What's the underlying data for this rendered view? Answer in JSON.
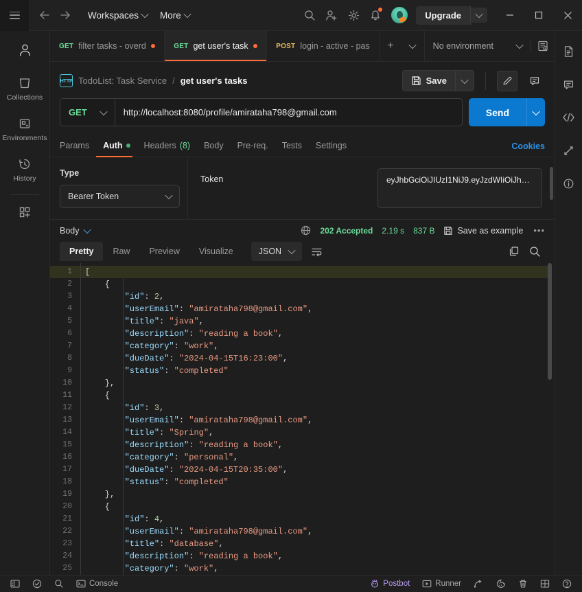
{
  "topbar": {
    "hamburger_icon": "hamburger-icon",
    "back_icon": "arrow-left-icon",
    "forward_icon": "arrow-right-icon",
    "workspaces_label": "Workspaces",
    "more_label": "More",
    "search_icon": "search-icon",
    "invite_icon": "user-plus-icon",
    "settings_icon": "gear-icon",
    "notifications_icon": "bell-icon",
    "avatar_name": "user-avatar",
    "upgrade_label": "Upgrade",
    "minimize_icon": "minimize-icon",
    "maximize_icon": "maximize-icon",
    "close_icon": "close-icon",
    "notification_dot_color": "#ff6c37"
  },
  "sidebar": {
    "avatar_icon": "person-icon",
    "items": [
      {
        "label": "Collections",
        "icon": "collections-icon"
      },
      {
        "label": "Environments",
        "icon": "environments-icon"
      },
      {
        "label": "History",
        "icon": "history-icon"
      }
    ],
    "new_icon": "new-grid-icon"
  },
  "tabs": {
    "items": [
      {
        "method": "GET",
        "name": "filter tasks - overdu",
        "unsaved": true,
        "active": false
      },
      {
        "method": "GET",
        "name": "get user's tasks",
        "unsaved": true,
        "active": true
      },
      {
        "method": "POST",
        "name": "login - active - pass",
        "unsaved": false,
        "active": false
      }
    ],
    "add_label": "+",
    "caret_icon": "chevron-down-icon",
    "environment_value": "No environment",
    "env_eye_icon": "environment-quick-look-icon"
  },
  "request": {
    "protocol_badge": "HTTP",
    "breadcrumb_parent": "TodoList: Task Service",
    "breadcrumb_sep": "/",
    "breadcrumb_current": "get user's tasks",
    "save_label": "Save",
    "save_icon": "save-disk-icon",
    "save_caret_icon": "chevron-down-icon",
    "edit_icon": "pencil-icon",
    "comment_icon": "comment-icon",
    "method": "GET",
    "url": "http://localhost:8080/profile/amirataha798@gmail.com",
    "send_label": "Send",
    "send_caret_icon": "chevron-down-icon",
    "send_color": "#0b79d0",
    "subtabs": [
      {
        "label": "Params",
        "active": false
      },
      {
        "label": "Auth",
        "active": true,
        "dot": true
      },
      {
        "label": "Headers",
        "count": "(8)",
        "active": false
      },
      {
        "label": "Body",
        "active": false
      },
      {
        "label": "Pre-req.",
        "active": false
      },
      {
        "label": "Tests",
        "active": false
      },
      {
        "label": "Settings",
        "active": false
      }
    ],
    "cookies_label": "Cookies"
  },
  "auth": {
    "type_label": "Type",
    "type_value": "Bearer Token",
    "type_caret_icon": "chevron-down-icon",
    "token_label": "Token",
    "token_value": "eyJhbGciOiJIUzI1NiJ9.eyJzdWIiOiJh…"
  },
  "response": {
    "body_label": "Body",
    "body_caret_icon": "chevron-down-icon",
    "globe_icon": "globe-icon",
    "status": "202 Accepted",
    "time": "2.19 s",
    "size": "837 B",
    "save_example_label": "Save as example",
    "save_example_icon": "save-disk-icon",
    "more_icon": "ellipsis-icon",
    "view_tabs": [
      {
        "label": "Pretty",
        "active": true
      },
      {
        "label": "Raw",
        "active": false
      },
      {
        "label": "Preview",
        "active": false
      },
      {
        "label": "Visualize",
        "active": false
      }
    ],
    "format": "JSON",
    "format_caret_icon": "chevron-down-icon",
    "wrap_icon": "word-wrap-icon",
    "copy_icon": "copy-icon",
    "search_icon": "search-icon"
  },
  "code": {
    "lines": [
      {
        "n": 1,
        "highlight": true,
        "tokens": [
          {
            "t": "[",
            "c": "p"
          }
        ]
      },
      {
        "n": 2,
        "tokens": [
          {
            "t": "    {",
            "c": "p"
          }
        ]
      },
      {
        "n": 3,
        "tokens": [
          {
            "t": "        ",
            "c": "p"
          },
          {
            "t": "\"id\"",
            "c": "k"
          },
          {
            "t": ": ",
            "c": "p"
          },
          {
            "t": "2",
            "c": "n"
          },
          {
            "t": ",",
            "c": "p"
          }
        ]
      },
      {
        "n": 4,
        "tokens": [
          {
            "t": "        ",
            "c": "p"
          },
          {
            "t": "\"userEmail\"",
            "c": "k"
          },
          {
            "t": ": ",
            "c": "p"
          },
          {
            "t": "\"amirataha798@gmail.com\"",
            "c": "s"
          },
          {
            "t": ",",
            "c": "p"
          }
        ]
      },
      {
        "n": 5,
        "tokens": [
          {
            "t": "        ",
            "c": "p"
          },
          {
            "t": "\"title\"",
            "c": "k"
          },
          {
            "t": ": ",
            "c": "p"
          },
          {
            "t": "\"java\"",
            "c": "s"
          },
          {
            "t": ",",
            "c": "p"
          }
        ]
      },
      {
        "n": 6,
        "tokens": [
          {
            "t": "        ",
            "c": "p"
          },
          {
            "t": "\"description\"",
            "c": "k"
          },
          {
            "t": ": ",
            "c": "p"
          },
          {
            "t": "\"reading a book\"",
            "c": "s"
          },
          {
            "t": ",",
            "c": "p"
          }
        ]
      },
      {
        "n": 7,
        "tokens": [
          {
            "t": "        ",
            "c": "p"
          },
          {
            "t": "\"category\"",
            "c": "k"
          },
          {
            "t": ": ",
            "c": "p"
          },
          {
            "t": "\"work\"",
            "c": "s"
          },
          {
            "t": ",",
            "c": "p"
          }
        ]
      },
      {
        "n": 8,
        "tokens": [
          {
            "t": "        ",
            "c": "p"
          },
          {
            "t": "\"dueDate\"",
            "c": "k"
          },
          {
            "t": ": ",
            "c": "p"
          },
          {
            "t": "\"2024-04-15T16:23:00\"",
            "c": "s"
          },
          {
            "t": ",",
            "c": "p"
          }
        ]
      },
      {
        "n": 9,
        "tokens": [
          {
            "t": "        ",
            "c": "p"
          },
          {
            "t": "\"status\"",
            "c": "k"
          },
          {
            "t": ": ",
            "c": "p"
          },
          {
            "t": "\"completed\"",
            "c": "s"
          }
        ]
      },
      {
        "n": 10,
        "tokens": [
          {
            "t": "    },",
            "c": "p"
          }
        ]
      },
      {
        "n": 11,
        "tokens": [
          {
            "t": "    {",
            "c": "p"
          }
        ]
      },
      {
        "n": 12,
        "tokens": [
          {
            "t": "        ",
            "c": "p"
          },
          {
            "t": "\"id\"",
            "c": "k"
          },
          {
            "t": ": ",
            "c": "p"
          },
          {
            "t": "3",
            "c": "n"
          },
          {
            "t": ",",
            "c": "p"
          }
        ]
      },
      {
        "n": 13,
        "tokens": [
          {
            "t": "        ",
            "c": "p"
          },
          {
            "t": "\"userEmail\"",
            "c": "k"
          },
          {
            "t": ": ",
            "c": "p"
          },
          {
            "t": "\"amirataha798@gmail.com\"",
            "c": "s"
          },
          {
            "t": ",",
            "c": "p"
          }
        ]
      },
      {
        "n": 14,
        "tokens": [
          {
            "t": "        ",
            "c": "p"
          },
          {
            "t": "\"title\"",
            "c": "k"
          },
          {
            "t": ": ",
            "c": "p"
          },
          {
            "t": "\"Spring\"",
            "c": "s"
          },
          {
            "t": ",",
            "c": "p"
          }
        ]
      },
      {
        "n": 15,
        "tokens": [
          {
            "t": "        ",
            "c": "p"
          },
          {
            "t": "\"description\"",
            "c": "k"
          },
          {
            "t": ": ",
            "c": "p"
          },
          {
            "t": "\"reading a book\"",
            "c": "s"
          },
          {
            "t": ",",
            "c": "p"
          }
        ]
      },
      {
        "n": 16,
        "tokens": [
          {
            "t": "        ",
            "c": "p"
          },
          {
            "t": "\"category\"",
            "c": "k"
          },
          {
            "t": ": ",
            "c": "p"
          },
          {
            "t": "\"personal\"",
            "c": "s"
          },
          {
            "t": ",",
            "c": "p"
          }
        ]
      },
      {
        "n": 17,
        "tokens": [
          {
            "t": "        ",
            "c": "p"
          },
          {
            "t": "\"dueDate\"",
            "c": "k"
          },
          {
            "t": ": ",
            "c": "p"
          },
          {
            "t": "\"2024-04-15T20:35:00\"",
            "c": "s"
          },
          {
            "t": ",",
            "c": "p"
          }
        ]
      },
      {
        "n": 18,
        "tokens": [
          {
            "t": "        ",
            "c": "p"
          },
          {
            "t": "\"status\"",
            "c": "k"
          },
          {
            "t": ": ",
            "c": "p"
          },
          {
            "t": "\"completed\"",
            "c": "s"
          }
        ]
      },
      {
        "n": 19,
        "tokens": [
          {
            "t": "    },",
            "c": "p"
          }
        ]
      },
      {
        "n": 20,
        "tokens": [
          {
            "t": "    {",
            "c": "p"
          }
        ]
      },
      {
        "n": 21,
        "tokens": [
          {
            "t": "        ",
            "c": "p"
          },
          {
            "t": "\"id\"",
            "c": "k"
          },
          {
            "t": ": ",
            "c": "p"
          },
          {
            "t": "4",
            "c": "n"
          },
          {
            "t": ",",
            "c": "p"
          }
        ]
      },
      {
        "n": 22,
        "tokens": [
          {
            "t": "        ",
            "c": "p"
          },
          {
            "t": "\"userEmail\"",
            "c": "k"
          },
          {
            "t": ": ",
            "c": "p"
          },
          {
            "t": "\"amirataha798@gmail.com\"",
            "c": "s"
          },
          {
            "t": ",",
            "c": "p"
          }
        ]
      },
      {
        "n": 23,
        "tokens": [
          {
            "t": "        ",
            "c": "p"
          },
          {
            "t": "\"title\"",
            "c": "k"
          },
          {
            "t": ": ",
            "c": "p"
          },
          {
            "t": "\"database\"",
            "c": "s"
          },
          {
            "t": ",",
            "c": "p"
          }
        ]
      },
      {
        "n": 24,
        "tokens": [
          {
            "t": "        ",
            "c": "p"
          },
          {
            "t": "\"description\"",
            "c": "k"
          },
          {
            "t": ": ",
            "c": "p"
          },
          {
            "t": "\"reading a book\"",
            "c": "s"
          },
          {
            "t": ",",
            "c": "p"
          }
        ]
      },
      {
        "n": 25,
        "tokens": [
          {
            "t": "        ",
            "c": "p"
          },
          {
            "t": "\"category\"",
            "c": "k"
          },
          {
            "t": ": ",
            "c": "p"
          },
          {
            "t": "\"work\"",
            "c": "s"
          },
          {
            "t": ",",
            "c": "p"
          }
        ]
      }
    ]
  },
  "rightrail": {
    "items": [
      {
        "icon": "documentation-icon"
      },
      {
        "icon": "comments-icon"
      },
      {
        "icon": "code-snippet-icon"
      },
      {
        "icon": "sync-changes-icon"
      },
      {
        "icon": "info-icon"
      }
    ]
  },
  "statusbar": {
    "sidebar_toggle_icon": "sidebar-toggle-icon",
    "check_icon": "check-circle-icon",
    "find_icon": "search-icon",
    "console_label": "Console",
    "console_icon": "terminal-icon",
    "postbot_label": "Postbot",
    "postbot_icon": "postbot-icon",
    "runner_label": "Runner",
    "runner_icon": "play-icon",
    "capture_icon": "capture-requests-icon",
    "cookies_icon": "cookie-icon",
    "trash_icon": "trash-icon",
    "layout_icon": "layout-icon",
    "help_icon": "help-icon"
  }
}
